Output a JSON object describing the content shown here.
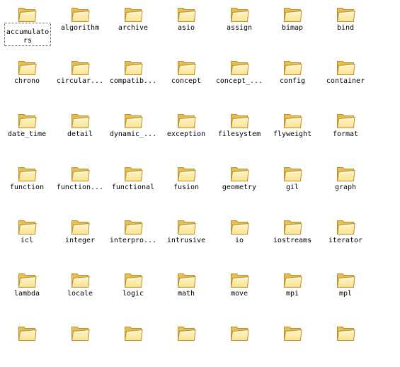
{
  "explorer": {
    "icon": "folder-icon",
    "folder_colors": {
      "back": "#E8BE4E",
      "front": "#FBE392",
      "front_light": "#FEF4C8",
      "outline": "#B8902A"
    },
    "selected_item": "accumulators",
    "rows": [
      [
        "accumulators",
        "algorithm",
        "archive",
        "asio",
        "assign",
        "bimap",
        "bind"
      ],
      [
        "chrono",
        "circular...",
        "compatib...",
        "concept",
        "concept_...",
        "config",
        "container"
      ],
      [
        "date_time",
        "detail",
        "dynamic_...",
        "exception",
        "filesystem",
        "flyweight",
        "format"
      ],
      [
        "function",
        "function...",
        "functional",
        "fusion",
        "geometry",
        "gil",
        "graph"
      ],
      [
        "icl",
        "integer",
        "interpro...",
        "intrusive",
        "io",
        "iostreams",
        "iterator"
      ],
      [
        "lambda",
        "locale",
        "logic",
        "math",
        "move",
        "mpi",
        "mpl"
      ],
      [
        "",
        "",
        "",
        "",
        "",
        "",
        ""
      ]
    ]
  }
}
